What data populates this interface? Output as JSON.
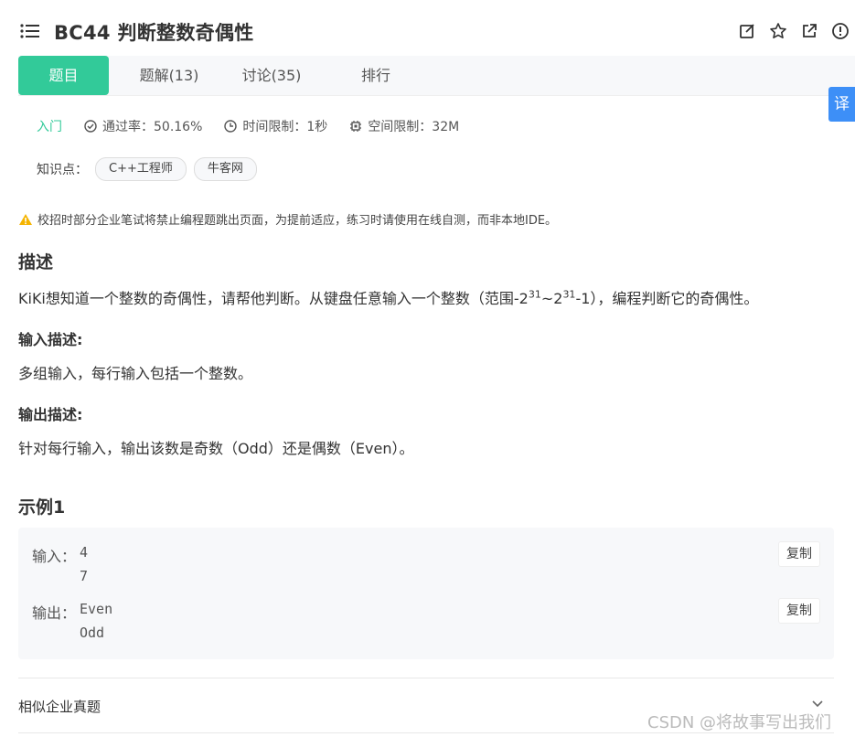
{
  "header": {
    "title": "BC44  判断整数奇偶性",
    "icons": [
      "edit-icon",
      "star-icon",
      "external-link-icon",
      "info-icon"
    ]
  },
  "tabs": [
    {
      "label": "题目",
      "active": true
    },
    {
      "label": "题解(13)",
      "active": false
    },
    {
      "label": "讨论(35)",
      "active": false
    },
    {
      "label": "排行",
      "active": false
    }
  ],
  "translate_label": "译",
  "meta": {
    "level": "入门",
    "pass_rate": "通过率：50.16%",
    "time_limit": "时间限制：1秒",
    "space_limit": "空间限制：32M"
  },
  "knowledge": {
    "label": "知识点：",
    "tags": [
      "C++工程师",
      "牛客网"
    ]
  },
  "warning": "校招时部分企业笔试将禁止编程题跳出页面，为提前适应，练习时请使用在线自测，而非本地IDE。",
  "description": {
    "heading": "描述",
    "text_before": "KiKi想知道一个整数的奇偶性，请帮他判断。从键盘任意输入一个整数（范围-2",
    "sup1": "31",
    "mid": "~2",
    "sup2": "31",
    "text_after": "-1），编程判断它的奇偶性。"
  },
  "input_desc": {
    "heading": "输入描述:",
    "text": "多组输入，每行输入包括一个整数。"
  },
  "output_desc": {
    "heading": "输出描述:",
    "text": "针对每行输入，输出该数是奇数（Odd）还是偶数（Even）。"
  },
  "example": {
    "heading": "示例1",
    "input_label": "输入：",
    "input_lines": [
      "4",
      "7"
    ],
    "output_label": "输出：",
    "output_lines": [
      "Even",
      "Odd"
    ],
    "copy_label": "复制"
  },
  "similar_label": "相似企业真题",
  "watermark": "CSDN @将故事写出我们"
}
